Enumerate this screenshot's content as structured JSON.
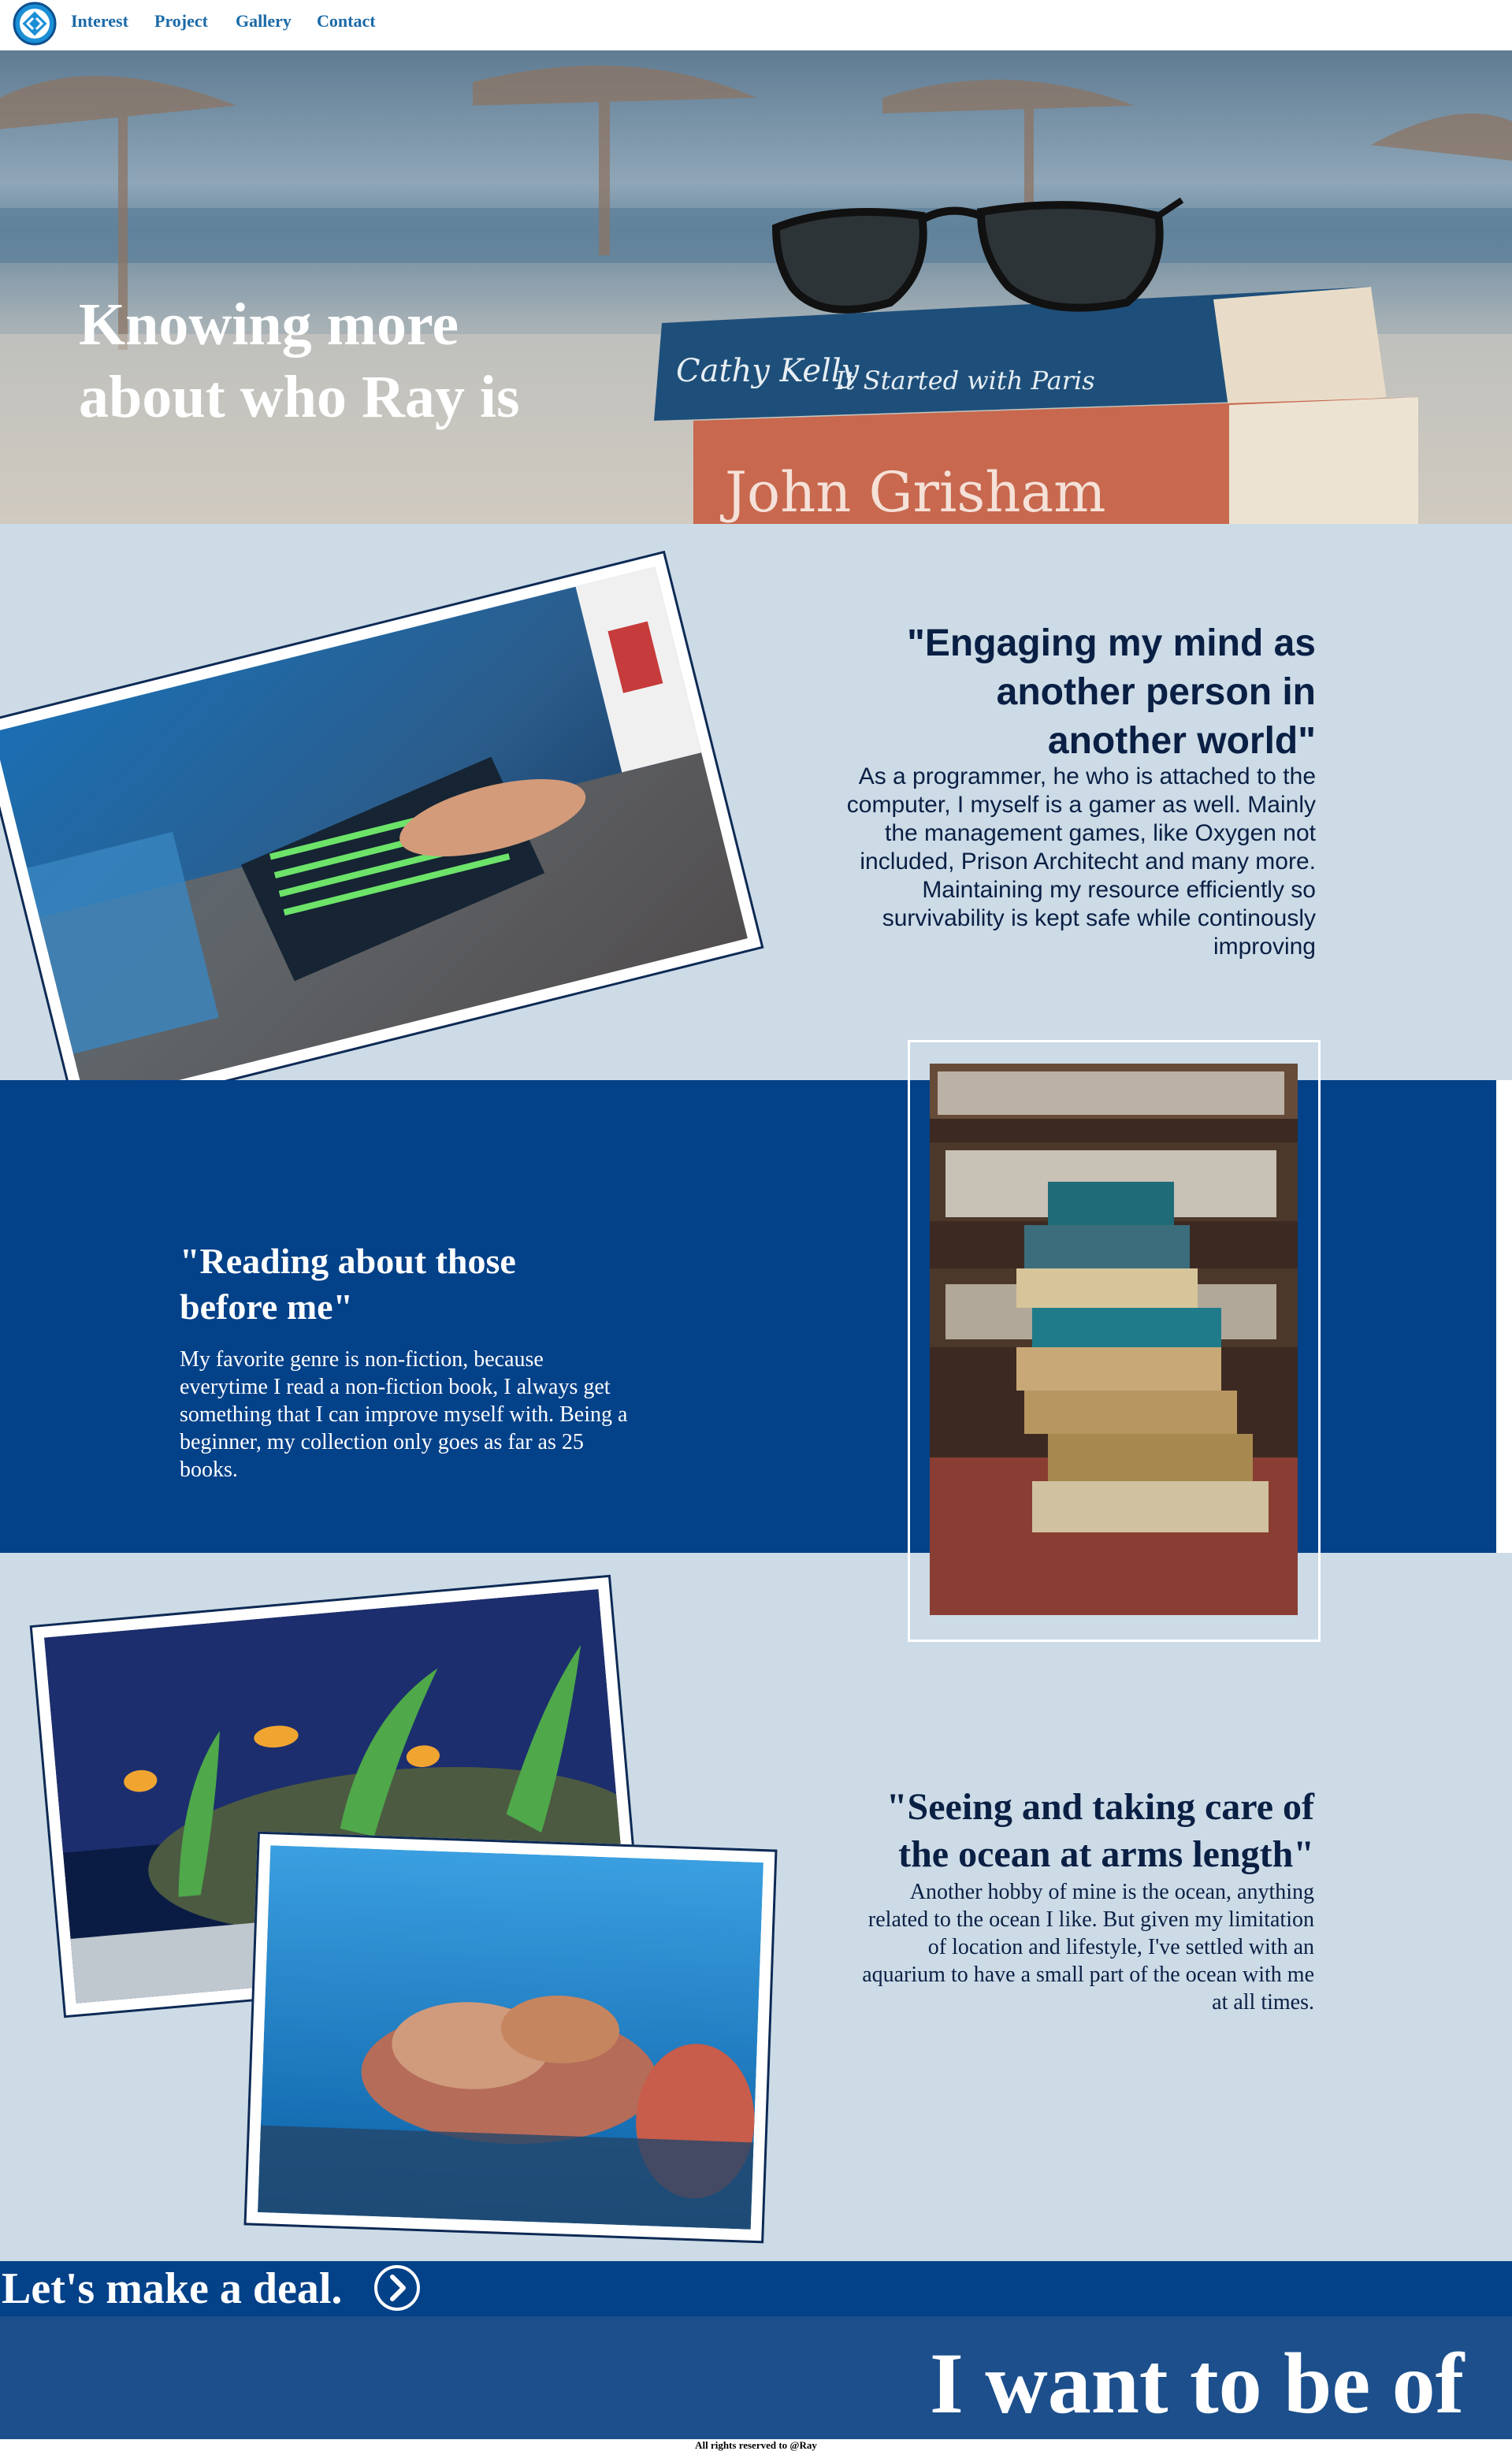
{
  "nav": {
    "logo_icon": "diamond-arrows-logo-icon",
    "links": [
      "Interest",
      "Project",
      "Gallery",
      "Contact"
    ],
    "link_color": "#1b6aa8"
  },
  "hero": {
    "title_line1": "Knowing more",
    "title_line2": "about who Ray is",
    "image": "sunglasses-on-books-beach-photo",
    "book_texts": [
      "Cathy Kelly",
      "It Started with Paris",
      "John Grisham"
    ]
  },
  "gaming": {
    "title_line1": "\"Engaging my mind as",
    "title_line2": "another person in",
    "title_line3": "another world\"",
    "body": "As a programmer, he who is attached to the computer, I myself is a gamer as well. Mainly the management games, like Oxygen not included, Prison Architecht and many more. Maintaining my resource efficiently so survivability is kept safe while continously improving",
    "image": "gaming-keyboard-photo"
  },
  "reading": {
    "title_line1": "\"Reading about those",
    "title_line2": "before me\"",
    "body": "My favorite genre is non-fiction, because everytime I read a non-fiction book, I always get something that I can improve myself with. Being a beginner, my collection only goes as far as 25 books.",
    "image": "stacked-books-photo"
  },
  "ocean": {
    "title_line1": "\"Seeing and taking care of",
    "title_line2": "the ocean at arms length\"",
    "body": "Another hobby of mine is the ocean, anything related to the ocean I like. But given my limitation of location and lifestyle, I've settled with an aquarium to have a small part of the ocean with me at all times.",
    "images": [
      "aquarium-fish-photo",
      "coral-reef-photo"
    ]
  },
  "cta": {
    "label": "Let's make a deal.",
    "icon": "chevron-right-circle-icon",
    "banner": "I want to be of"
  },
  "footer": {
    "text": "All rights reserved to @Ray"
  },
  "colors": {
    "light_bg": "#ccdbe6",
    "dark_bg": "#034189",
    "banner_bg": "#1c4f8c",
    "heading": "#0a1f44"
  }
}
